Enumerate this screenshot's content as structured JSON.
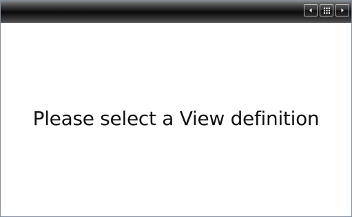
{
  "window": {
    "colors": {
      "border": "#7f8ea3",
      "titlebar": "#151515",
      "background": "#ffffff",
      "text": "#111111"
    }
  },
  "toolbar": {
    "buttons": [
      {
        "icon": "triangle-left-icon"
      },
      {
        "icon": "grid-icon"
      },
      {
        "icon": "triangle-right-icon"
      }
    ]
  },
  "main": {
    "message": "Please select a View definition"
  }
}
